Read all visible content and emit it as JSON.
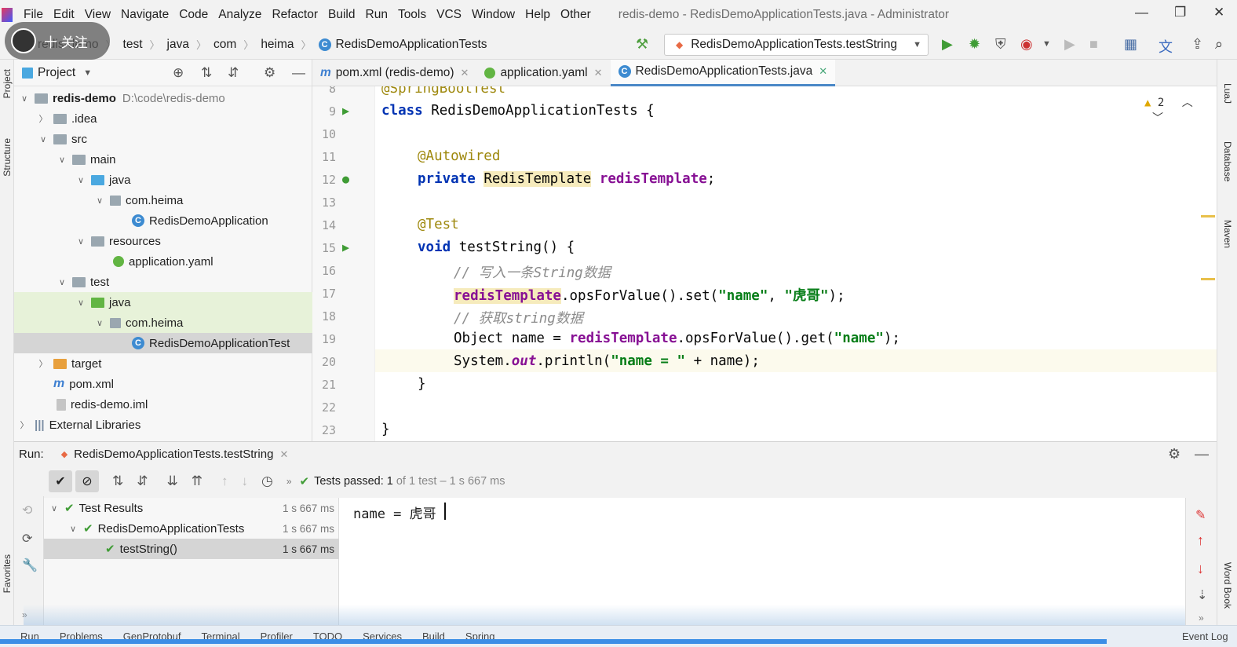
{
  "menubar": {
    "items": [
      "File",
      "Edit",
      "View",
      "Navigate",
      "Code",
      "Analyze",
      "Refactor",
      "Build",
      "Run",
      "Tools",
      "VCS",
      "Window",
      "Help",
      "Other"
    ],
    "window_title": "redis-demo - RedisDemoApplicationTests.java - Administrator"
  },
  "overlay": {
    "follow_label": "十 关注"
  },
  "breadcrumbs": [
    "redis-demo",
    "test",
    "java",
    "com",
    "heima",
    "RedisDemoApplicationTests"
  ],
  "run_config": {
    "label": "RedisDemoApplicationTests.testString"
  },
  "project_panel": {
    "title": "Project",
    "tree": [
      {
        "label": "redis-demo",
        "path": "D:\\code\\redis-demo"
      },
      {
        "label": ".idea"
      },
      {
        "label": "src"
      },
      {
        "label": "main"
      },
      {
        "label": "java"
      },
      {
        "label": "com.heima"
      },
      {
        "label": "RedisDemoApplication"
      },
      {
        "label": "resources"
      },
      {
        "label": "application.yaml"
      },
      {
        "label": "test"
      },
      {
        "label": "java"
      },
      {
        "label": "com.heima"
      },
      {
        "label": "RedisDemoApplicationTest"
      },
      {
        "label": "target"
      },
      {
        "label": "pom.xml"
      },
      {
        "label": "redis-demo.iml"
      },
      {
        "label": "External Libraries"
      }
    ]
  },
  "editor": {
    "tabs": [
      {
        "label": "pom.xml (redis-demo)"
      },
      {
        "label": "application.yaml"
      },
      {
        "label": "RedisDemoApplicationTests.java"
      }
    ],
    "warning_count": "2",
    "line_numbers": [
      "8",
      "9",
      "10",
      "11",
      "12",
      "13",
      "14",
      "15",
      "16",
      "17",
      "18",
      "19",
      "20",
      "21",
      "22",
      "23"
    ],
    "code": {
      "l8": "@SpringBootTest",
      "l9_kw": "class",
      "l9_rest": " RedisDemoApplicationTests {",
      "l11": "@Autowired",
      "l12_kw": "private",
      "l12_type": "RedisTemplate",
      "l12_field": "redisTemplate",
      "l12_end": ";",
      "l14": "@Test",
      "l15_kw": "void",
      "l15_rest": " testString() {",
      "l16": "// 写入一条String数据",
      "l17_field": "redisTemplate",
      "l17_mid": ".opsForValue().set(",
      "l17_s1": "\"name\"",
      "l17_comma": ", ",
      "l17_s2": "\"虎哥\"",
      "l17_end": ");",
      "l18": "// 获取string数据",
      "l19_a": "Object name = ",
      "l19_field": "redisTemplate",
      "l19_mid": ".opsForValue().get(",
      "l19_s": "\"name\"",
      "l19_end": ");",
      "l20_a": "System.",
      "l20_out": "out",
      "l20_mid": ".println(",
      "l20_s": "\"name = \"",
      "l20_end": " + name);",
      "l21": "}",
      "l23": "}"
    }
  },
  "run_panel": {
    "label": "Run:",
    "tab": "RedisDemoApplicationTests.testString",
    "status_prefix": "Tests passed:",
    "status_count": "1",
    "status_suffix": "of 1 test – 1 s 667 ms",
    "tests": [
      {
        "label": "Test Results",
        "duration": "1 s 667 ms"
      },
      {
        "label": "RedisDemoApplicationTests",
        "duration": "1 s 667 ms"
      },
      {
        "label": "testString()",
        "duration": "1 s 667 ms"
      }
    ],
    "console_output": "name = 虎哥"
  },
  "side_labels": {
    "left": [
      "Project",
      "Structure",
      "Favorites"
    ],
    "right": [
      "LuaJ",
      "Database",
      "Maven",
      "Word Book"
    ]
  },
  "bottombar": {
    "items": [
      "Run",
      "Problems",
      "GenProtobuf",
      "Terminal",
      "Profiler",
      "TODO",
      "Services",
      "Build",
      "Spring"
    ],
    "event_log": "Event Log"
  }
}
